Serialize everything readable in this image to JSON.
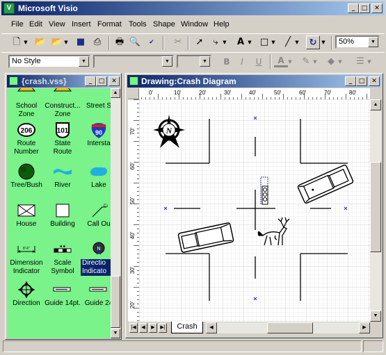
{
  "app": {
    "title": "Microsoft Visio"
  },
  "menu": [
    "File",
    "Edit",
    "View",
    "Insert",
    "Format",
    "Tools",
    "Shape",
    "Window",
    "Help"
  ],
  "toolbar": {
    "zoom": "50%"
  },
  "format_bar": {
    "style": "No Style",
    "bold": "B",
    "italic": "I",
    "underline": "U",
    "font_color": "A"
  },
  "stencil": {
    "title": "{crash.vss}",
    "items": [
      {
        "label": "School\nZone",
        "icon": "school-zone-icon"
      },
      {
        "label": "Construct...\nZone",
        "icon": "construction-zone-icon"
      },
      {
        "label": "Street S",
        "icon": "street-sign-icon"
      },
      {
        "label": "Route\nNumber",
        "icon": "route-number-icon",
        "text": "206"
      },
      {
        "label": "State Route",
        "icon": "state-route-icon",
        "text": "101"
      },
      {
        "label": "Intersta",
        "icon": "interstate-icon",
        "text": "90"
      },
      {
        "label": "Tree/Bush",
        "icon": "tree-icon"
      },
      {
        "label": "River",
        "icon": "river-icon"
      },
      {
        "label": "Lake",
        "icon": "lake-icon"
      },
      {
        "label": "House",
        "icon": "house-icon"
      },
      {
        "label": "Building",
        "icon": "building-icon"
      },
      {
        "label": "Call Ou",
        "icon": "callout-icon"
      },
      {
        "label": "Dimension\nIndicator",
        "icon": "dimension-icon"
      },
      {
        "label": "Scale\nSymbol",
        "icon": "scale-icon"
      },
      {
        "label": "Directio\nIndicato",
        "icon": "direction-indicator-icon"
      },
      {
        "label": "Direction",
        "icon": "direction-icon"
      },
      {
        "label": "Guide 14pt.",
        "icon": "guide14-icon"
      },
      {
        "label": "Guide 24",
        "icon": "guide24-icon"
      }
    ]
  },
  "drawing": {
    "title": "Drawing:Crash Diagram",
    "tab": "Crash",
    "hruler": [
      "0'",
      "10'",
      "20'",
      "30'",
      "40'",
      "50'",
      "60'",
      "70'",
      "80'"
    ],
    "vruler": [
      "70'",
      "60'",
      "50'",
      "40'",
      "30'",
      "20'"
    ],
    "compass_letter": "N"
  }
}
